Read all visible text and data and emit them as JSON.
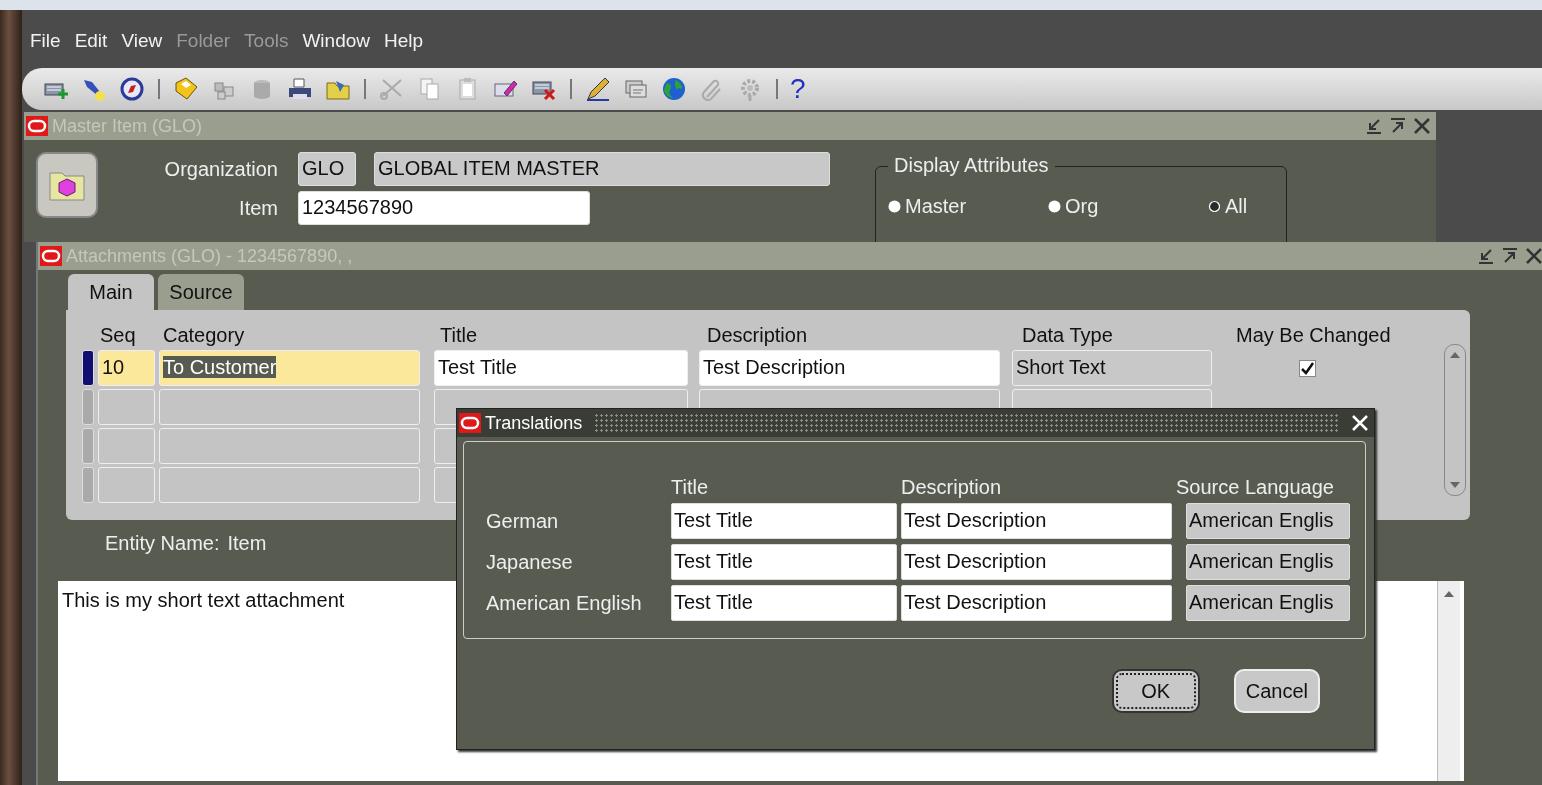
{
  "menu": [
    {
      "label": "File",
      "disabled": false
    },
    {
      "label": "Edit",
      "disabled": false
    },
    {
      "label": "View",
      "disabled": false
    },
    {
      "label": "Folder",
      "disabled": true
    },
    {
      "label": "Tools",
      "disabled": true
    },
    {
      "label": "Window",
      "disabled": false
    },
    {
      "label": "Help",
      "disabled": false
    }
  ],
  "toolbar": [
    {
      "kind": "button",
      "disabled": false
    },
    {
      "kind": "button",
      "disabled": false
    },
    {
      "kind": "button",
      "disabled": false
    },
    {
      "kind": "separator"
    },
    {
      "kind": "button",
      "disabled": false
    },
    {
      "kind": "button",
      "disabled": true
    },
    {
      "kind": "button",
      "disabled": true
    },
    {
      "kind": "button",
      "disabled": false
    },
    {
      "kind": "button",
      "disabled": false
    },
    {
      "kind": "separator"
    },
    {
      "kind": "button",
      "disabled": true
    },
    {
      "kind": "button",
      "disabled": true
    },
    {
      "kind": "button",
      "disabled": true
    },
    {
      "kind": "button",
      "disabled": false
    },
    {
      "kind": "button",
      "disabled": false
    },
    {
      "kind": "separator"
    },
    {
      "kind": "button",
      "disabled": false
    },
    {
      "kind": "button",
      "disabled": true
    },
    {
      "kind": "button",
      "disabled": false
    },
    {
      "kind": "button",
      "disabled": true
    },
    {
      "kind": "button",
      "disabled": true
    },
    {
      "kind": "separator"
    },
    {
      "kind": "glyph",
      "text": "?",
      "disabled": false
    }
  ],
  "master_window": {
    "title": "Master Item (GLO)",
    "active": false,
    "organization": {
      "label": "Organization",
      "code": "GLO",
      "name": "GLOBAL ITEM MASTER"
    },
    "item": {
      "label": "Item",
      "value": "1234567890"
    },
    "display_attributes": {
      "legend": "Display Attributes",
      "options": [
        {
          "label": "Master",
          "selected": true
        },
        {
          "label": "Org",
          "selected": true
        },
        {
          "label": "All",
          "selected": false
        }
      ]
    }
  },
  "attachments_window": {
    "title": "Attachments (GLO) - 1234567890, ,",
    "active": false,
    "tabs": [
      {
        "label": "Main",
        "selected": true
      },
      {
        "label": "Source",
        "selected": false
      }
    ],
    "columns": [
      "Seq",
      "Category",
      "Title",
      "Description",
      "Data Type",
      "May Be Changed"
    ],
    "rows": [
      {
        "current": true,
        "seq": "10",
        "category": "To Customer",
        "category_highlighted": true,
        "title": "Test Title",
        "description": "Test Description",
        "data_type": "Short Text",
        "may_be_changed": true
      },
      {
        "current": false
      },
      {
        "current": false
      },
      {
        "current": false
      }
    ],
    "entity_label": "Entity Name:",
    "entity_value": "Item",
    "text": "This is my short text attachment"
  },
  "translations_dialog": {
    "title": "Translations",
    "active": true,
    "columns": [
      "Title",
      "Description",
      "Source Language"
    ],
    "rows": [
      {
        "language": "German",
        "title": "Test Title",
        "description": "Test Description",
        "source_language": "American Englis"
      },
      {
        "language": "Japanese",
        "title": "Test Title",
        "description": "Test Description",
        "source_language": "American Englis"
      },
      {
        "language": "American English",
        "title": "Test Title",
        "description": "Test Description",
        "source_language": "American Englis"
      }
    ],
    "buttons": [
      {
        "label": "OK",
        "focused": true
      },
      {
        "label": "Cancel",
        "focused": false
      }
    ]
  }
}
